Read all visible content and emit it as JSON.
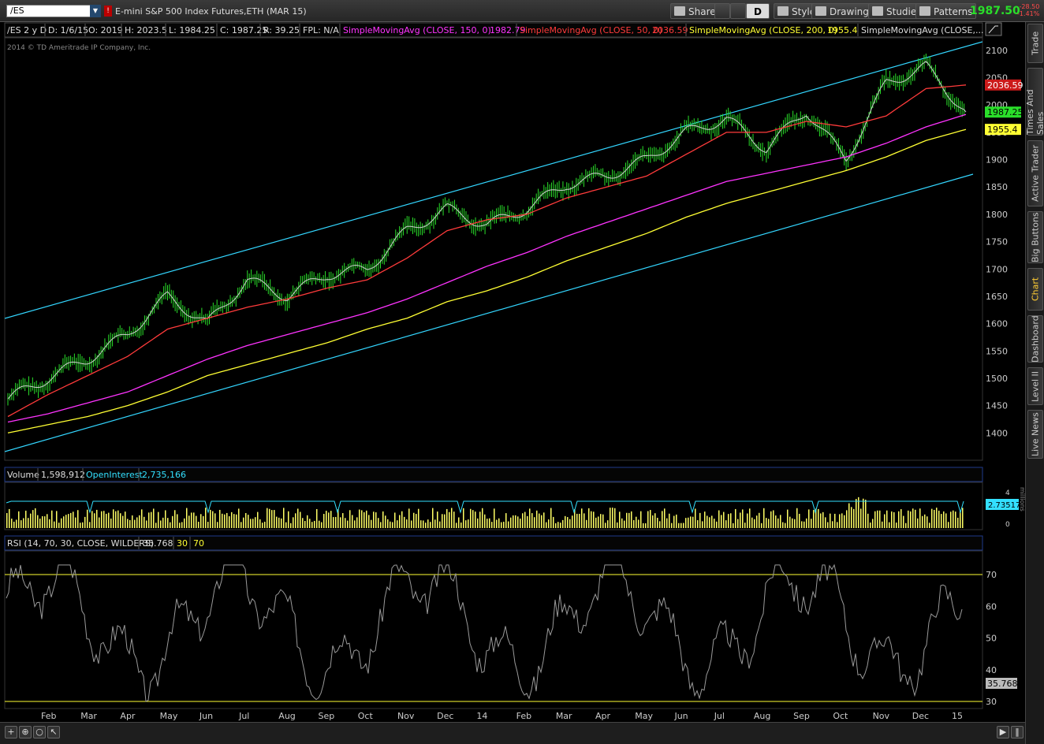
{
  "header": {
    "symbol": "/ES",
    "symbol_flag": "!",
    "description": "E-mini S&P 500 Index Futures,ETH (MAR 15)",
    "buttons": {
      "share": "Share",
      "period": "D",
      "style": "Style",
      "drawings": "Drawings",
      "studies": "Studies",
      "patterns": "Patterns"
    },
    "last_price": "1987.50",
    "net_change": "-28.50",
    "pct_change": "-1.41%"
  },
  "info_bar": {
    "chart_label": "/ES 2 y D",
    "date": "D: 1/6/15",
    "open": "O: 2019",
    "high": "H: 2023.5",
    "low": "L: 1984.25",
    "close": "C: 1987.25",
    "range": "R: 39.25",
    "fpl": "FPL: N/A",
    "studies": [
      {
        "label": "SimpleMovingAvg (CLOSE, 150, 0)",
        "value": "1982.79",
        "color": "#ff33ff"
      },
      {
        "label": "SimpleMovingAvg (CLOSE, 50, 0)",
        "value": "2036.59",
        "color": "#ff3b3b"
      },
      {
        "label": "SimpleMovingAvg (CLOSE, 200, 0)",
        "value": "1955.4",
        "color": "#ffff33"
      },
      {
        "label": "SimpleMovingAvg (CLOSE,...",
        "value": "",
        "color": "#dddddd"
      }
    ]
  },
  "copyright": "2014 © TD Ameritrade IP Company, Inc.",
  "price_axis": {
    "ticks": [
      "2100",
      "2050",
      "2000",
      "1950",
      "1900",
      "1850",
      "1800",
      "1750",
      "1700",
      "1650",
      "1600",
      "1550",
      "1500",
      "1450",
      "1400"
    ],
    "badges": [
      {
        "label": "2036.59",
        "bg": "#cc1a1a",
        "fg": "#ffffff"
      },
      {
        "label": "1987.25",
        "bg": "#2adf2a",
        "fg": "#000000"
      },
      {
        "label": "1955.4",
        "bg": "#ffff33",
        "fg": "#000000"
      }
    ]
  },
  "volume_panel": {
    "label": "Volume",
    "value": "1,598,912",
    "oi_label": "OpenInterest",
    "oi_value": "2,735,166",
    "badge": "2.73517",
    "axis_ticks": [
      "4",
      "2",
      "0"
    ],
    "units": "millions"
  },
  "rsi_panel": {
    "label": "RSI (14, 70, 30, CLOSE, WILDERS)",
    "value": "35.768",
    "over_sold": "30",
    "over_bought": "70",
    "axis_ticks": [
      "70",
      "60",
      "50",
      "40",
      "30"
    ],
    "badge": "35.768"
  },
  "time_axis": [
    "Feb",
    "Mar",
    "Apr",
    "May",
    "Jun",
    "Jul",
    "Aug",
    "Sep",
    "Oct",
    "Nov",
    "Dec",
    "14",
    "Feb",
    "Mar",
    "Apr",
    "May",
    "Jun",
    "Jul",
    "Aug",
    "Sep",
    "Oct",
    "Nov",
    "Dec",
    "15"
  ],
  "sidebar_tabs": [
    {
      "label": "Trade",
      "active": false
    },
    {
      "label": "Times And Sales",
      "active": false
    },
    {
      "label": "Active Trader",
      "active": false
    },
    {
      "label": "Big Buttons",
      "active": false
    },
    {
      "label": "Chart",
      "active": true
    },
    {
      "label": "Dashboard",
      "active": false
    },
    {
      "label": "Level II",
      "active": false
    },
    {
      "label": "Live News",
      "active": false
    }
  ],
  "chart_data": {
    "type": "line",
    "title": "/ES 2 y D",
    "ylim": [
      1350,
      2120
    ],
    "x": [
      "Jan 13",
      "Feb 13",
      "Mar 13",
      "Apr 13",
      "May 13",
      "Jun 13",
      "Jul 13",
      "Aug 13",
      "Sep 13",
      "Oct 13",
      "Nov 13",
      "Dec 13",
      "Jan 14",
      "Feb 14",
      "Mar 14",
      "Apr 14",
      "May 14",
      "Jun 14",
      "Jul 14",
      "Aug 14",
      "Sep 14",
      "Oct 14",
      "Nov 14",
      "Dec 14",
      "Jan 15"
    ],
    "series": [
      {
        "name": "Close",
        "color": "#2adf2a",
        "values": [
          1462,
          1500,
          1535,
          1580,
          1650,
          1600,
          1680,
          1650,
          1690,
          1700,
          1770,
          1810,
          1780,
          1810,
          1855,
          1870,
          1900,
          1950,
          1975,
          1920,
          1990,
          1900,
          2040,
          2070,
          1987
        ]
      },
      {
        "name": "SimpleMovingAvg (CLOSE, 50, 0)",
        "color": "#ff3b3b",
        "values": [
          1430,
          1470,
          1505,
          1540,
          1590,
          1610,
          1630,
          1645,
          1665,
          1680,
          1720,
          1770,
          1790,
          1800,
          1830,
          1850,
          1870,
          1910,
          1950,
          1950,
          1970,
          1960,
          1980,
          2030,
          2036.59
        ]
      },
      {
        "name": "SimpleMovingAvg (CLOSE, 150, 0)",
        "color": "#ff33ff",
        "values": [
          1420,
          1435,
          1455,
          1475,
          1505,
          1535,
          1560,
          1580,
          1600,
          1620,
          1645,
          1675,
          1705,
          1730,
          1760,
          1785,
          1810,
          1835,
          1860,
          1875,
          1890,
          1905,
          1930,
          1960,
          1982.79
        ]
      },
      {
        "name": "SimpleMovingAvg (CLOSE, 200, 0)",
        "color": "#ffff33",
        "values": [
          1400,
          1415,
          1430,
          1450,
          1475,
          1505,
          1525,
          1545,
          1565,
          1590,
          1610,
          1640,
          1660,
          1685,
          1715,
          1740,
          1765,
          1795,
          1820,
          1840,
          1860,
          1880,
          1905,
          1935,
          1955.4
        ]
      }
    ]
  }
}
